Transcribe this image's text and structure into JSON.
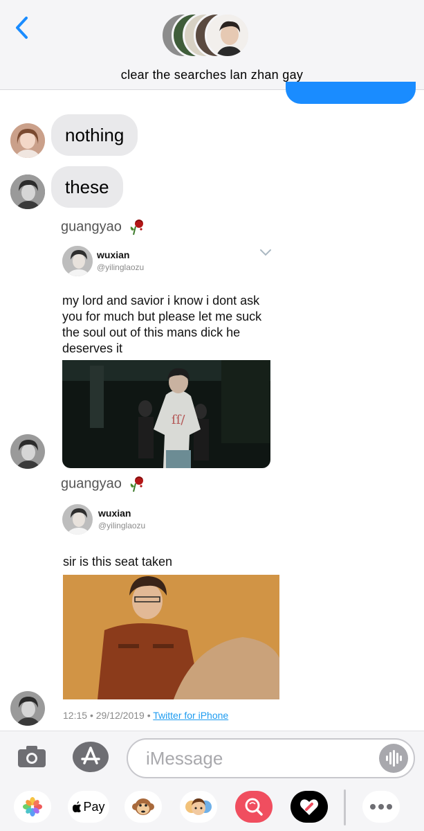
{
  "header": {
    "group_title": "clear the searches lan zhan gay",
    "back_icon": "chevron-left-icon"
  },
  "colors": {
    "imessage_blue": "#1a8cff",
    "bubble_gray": "#e9e9eb",
    "link_blue": "#1d9bf0",
    "header_bg": "#f5f5f7"
  },
  "messages": [
    {
      "type": "text",
      "text": "nothing"
    },
    {
      "type": "text",
      "text": "these"
    }
  ],
  "tweets": [
    {
      "sender": "guangyao",
      "sender_emoji": "wilted-rose",
      "name": "wuxian",
      "handle": "@yilinglaozu",
      "text": "my lord and savior i know i dont ask you for much but please let me suck the soul out of this mans dick he deserves it",
      "media": "dance-photo"
    },
    {
      "sender": "guangyao",
      "sender_emoji": "wilted-rose",
      "name": "wuxian",
      "handle": "@yilinglaozu",
      "text": "sir is this seat taken",
      "media": "portrait-photo",
      "time": "12:15",
      "sep": "•",
      "date": "29/12/2019",
      "sep2": "•",
      "source": "Twitter for iPhone"
    }
  ],
  "input": {
    "placeholder": "iMessage",
    "camera_icon": "camera-icon",
    "apps_icon": "app-store-icon",
    "audio_icon": "audio-waveform-icon"
  },
  "app_drawer": [
    {
      "name": "photos-icon"
    },
    {
      "name": "apple-pay",
      "label": "Pay"
    },
    {
      "name": "monkey-memoji-icon"
    },
    {
      "name": "memoji-icon"
    },
    {
      "name": "search-images-icon"
    },
    {
      "name": "digital-touch-icon"
    },
    {
      "name": "more-icon"
    }
  ]
}
